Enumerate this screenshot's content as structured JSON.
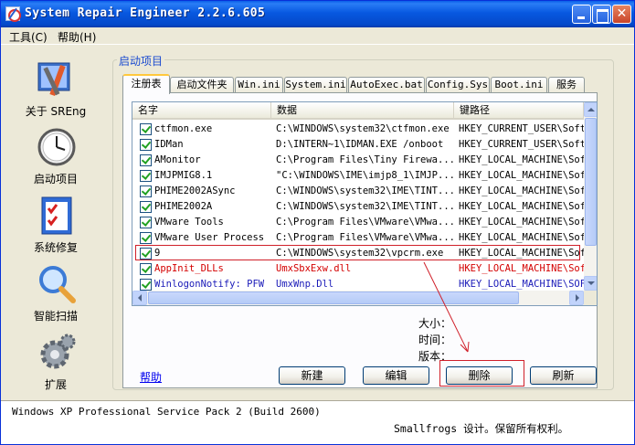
{
  "window": {
    "title": "System Repair Engineer 2.2.6.605"
  },
  "menu": [
    "工具(C)",
    "帮助(H)"
  ],
  "nav": [
    {
      "label": "关于 SREng",
      "icon": "tools-icon"
    },
    {
      "label": "启动项目",
      "icon": "clock-icon"
    },
    {
      "label": "系统修复",
      "icon": "checklist-icon"
    },
    {
      "label": "智能扫描",
      "icon": "magnifier-icon"
    },
    {
      "label": "扩展",
      "icon": "gear-icon"
    }
  ],
  "group_title": "启动项目",
  "tabs": [
    "注册表",
    "启动文件夹",
    "Win.ini",
    "System.ini",
    "AutoExec.bat",
    "Config.Sys",
    "Boot.ini",
    "服务"
  ],
  "active_tab": "注册表",
  "list": {
    "columns": [
      "名字",
      "数据",
      "键路径"
    ],
    "rows": [
      {
        "name": "ctfmon.exe",
        "data": "C:\\WINDOWS\\system32\\ctfmon.exe",
        "key": "HKEY_CURRENT_USER\\Soft",
        "checked": true,
        "color": "normal"
      },
      {
        "name": "IDMan",
        "data": "D:\\INTERN~1\\IDMAN.EXE /onboot",
        "key": "HKEY_CURRENT_USER\\Soft",
        "checked": true,
        "color": "normal"
      },
      {
        "name": "AMonitor",
        "data": "C:\\Program Files\\Tiny Firewa...",
        "key": "HKEY_LOCAL_MACHINE\\Sof",
        "checked": true,
        "color": "normal"
      },
      {
        "name": "IMJPMIG8.1",
        "data": "\"C:\\WINDOWS\\IME\\imjp8_1\\IMJP...",
        "key": "HKEY_LOCAL_MACHINE\\Sof",
        "checked": true,
        "color": "normal"
      },
      {
        "name": "PHIME2002ASync",
        "data": "C:\\WINDOWS\\system32\\IME\\TINT...",
        "key": "HKEY_LOCAL_MACHINE\\Sof",
        "checked": true,
        "color": "normal"
      },
      {
        "name": "PHIME2002A",
        "data": "C:\\WINDOWS\\system32\\IME\\TINT...",
        "key": "HKEY_LOCAL_MACHINE\\Sof",
        "checked": true,
        "color": "normal"
      },
      {
        "name": "VMware Tools",
        "data": "C:\\Program Files\\VMware\\VMwa...",
        "key": "HKEY_LOCAL_MACHINE\\Sof",
        "checked": true,
        "color": "normal"
      },
      {
        "name": "VMware User Process",
        "data": "C:\\Program Files\\VMware\\VMwa...",
        "key": "HKEY_LOCAL_MACHINE\\Sof",
        "checked": true,
        "color": "normal"
      },
      {
        "name": "9",
        "data": "C:\\WINDOWS\\system32\\vpcrm.exe",
        "key": "HKEY_LOCAL_MACHINE\\Sof",
        "checked": true,
        "color": "normal"
      },
      {
        "name": "AppInit_DLLs",
        "data": "UmxSbxExw.dll",
        "key": "HKEY_LOCAL_MACHINE\\Sof",
        "checked": true,
        "color": "red"
      },
      {
        "name": "WinlogonNotify: PFW",
        "data": "UmxWnp.Dll",
        "key": "HKEY_LOCAL_MACHINE\\SOF",
        "checked": true,
        "color": "blue"
      }
    ]
  },
  "info": {
    "size_label": "大小：",
    "time_label": "时间：",
    "version_label": "版本："
  },
  "buttons": {
    "help": "帮助",
    "new": "新建",
    "edit": "编辑",
    "delete": "删除",
    "refresh": "刷新"
  },
  "status": {
    "os": "Windows XP Professional Service Pack 2 (Build 2600)",
    "copyright": "Smallfrogs 设计。保留所有权利。"
  },
  "colors": {
    "titlebar": "#0758e0",
    "highlight": "#d0202a",
    "link": "#0000ee",
    "red_entry": "#d40000",
    "blue_entry": "#1a1ab8"
  }
}
